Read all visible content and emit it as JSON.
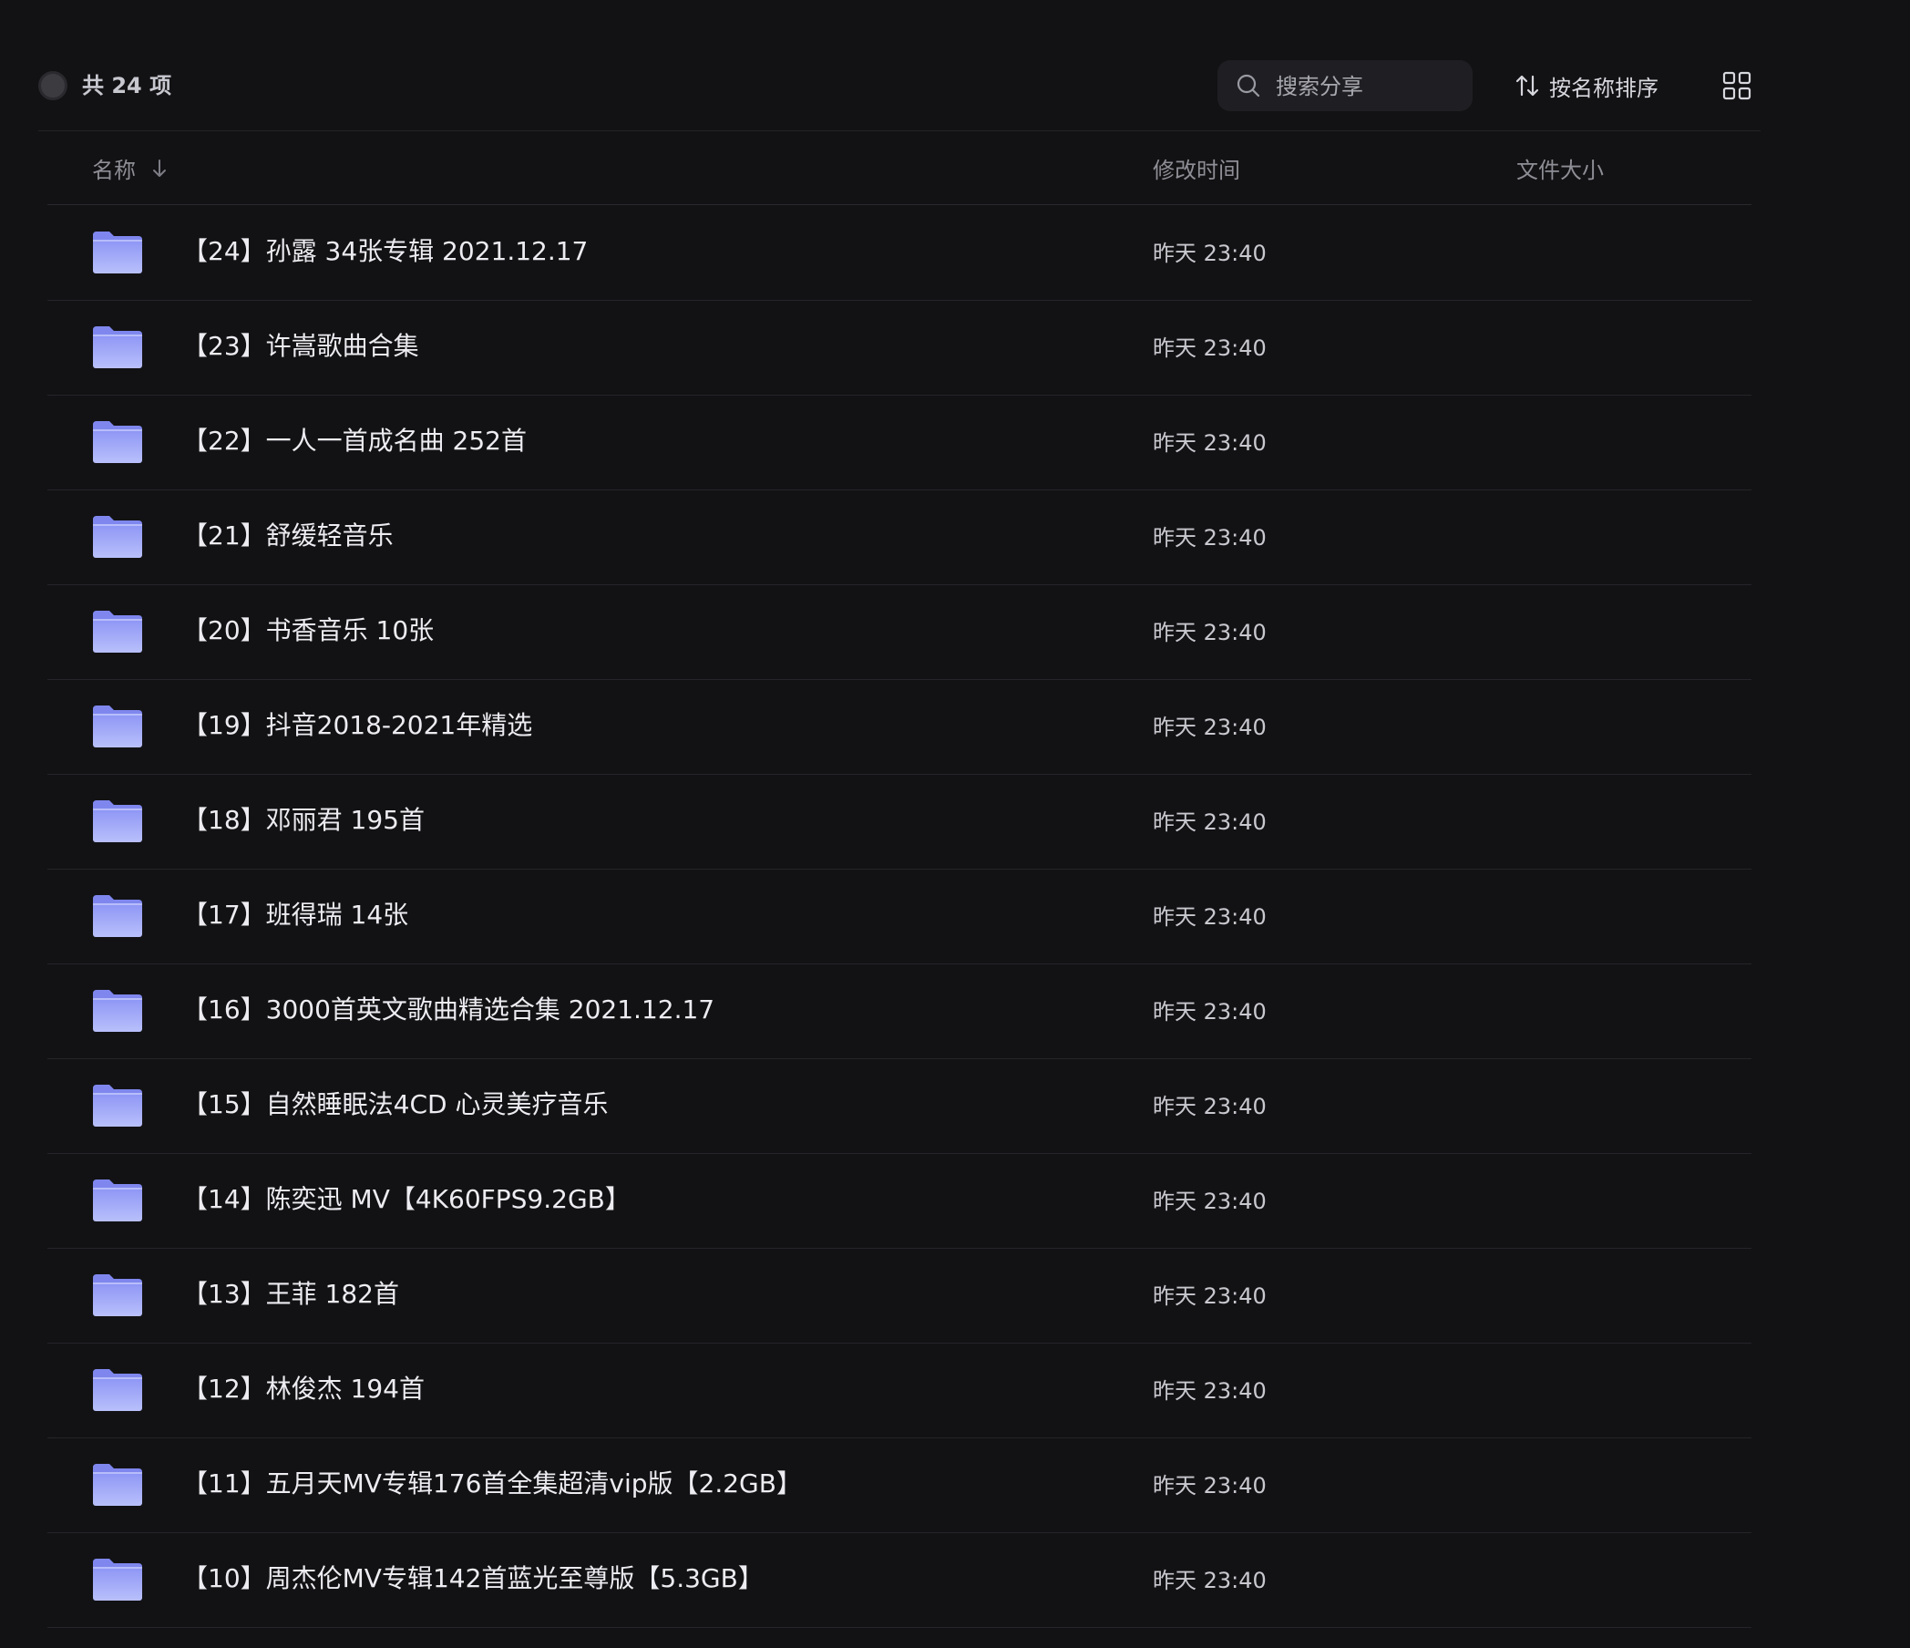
{
  "toolbar": {
    "count_label": "共 24 项",
    "search_placeholder": "搜索分享",
    "sort_label": "按名称排序"
  },
  "columns": {
    "name": "名称",
    "modified": "修改时间",
    "size": "文件大小"
  },
  "colors": {
    "background": "#121214",
    "folder_top": "#8d95f5",
    "folder_bottom": "#b9c0fb"
  },
  "icons": {
    "select": "circle-checkbox",
    "search": "search-icon",
    "sort": "sort-arrows-icon",
    "view": "grid-view-icon",
    "sort_direction": "arrow-down-icon",
    "item": "folder-icon"
  },
  "files": [
    {
      "name": "【24】孙露 34张专辑 2021.12.17",
      "modified": "昨天 23:40",
      "size": ""
    },
    {
      "name": "【23】许嵩歌曲合集",
      "modified": "昨天 23:40",
      "size": ""
    },
    {
      "name": "【22】一人一首成名曲 252首",
      "modified": "昨天 23:40",
      "size": ""
    },
    {
      "name": "【21】舒缓轻音乐",
      "modified": "昨天 23:40",
      "size": ""
    },
    {
      "name": "【20】书香音乐 10张",
      "modified": "昨天 23:40",
      "size": ""
    },
    {
      "name": "【19】抖音2018-2021年精选",
      "modified": "昨天 23:40",
      "size": ""
    },
    {
      "name": "【18】邓丽君 195首",
      "modified": "昨天 23:40",
      "size": ""
    },
    {
      "name": "【17】班得瑞 14张",
      "modified": "昨天 23:40",
      "size": ""
    },
    {
      "name": "【16】3000首英文歌曲精选合集 2021.12.17",
      "modified": "昨天 23:40",
      "size": ""
    },
    {
      "name": "【15】自然睡眠法4CD 心灵美疗音乐",
      "modified": "昨天 23:40",
      "size": ""
    },
    {
      "name": "【14】陈奕迅 MV【4K60FPS9.2GB】",
      "modified": "昨天 23:40",
      "size": ""
    },
    {
      "name": "【13】王菲 182首",
      "modified": "昨天 23:40",
      "size": ""
    },
    {
      "name": "【12】林俊杰 194首",
      "modified": "昨天 23:40",
      "size": ""
    },
    {
      "name": "【11】五月天MV专辑176首全集超清vip版【2.2GB】",
      "modified": "昨天 23:40",
      "size": ""
    },
    {
      "name": "【10】周杰伦MV专辑142首蓝光至尊版【5.3GB】",
      "modified": "昨天 23:40",
      "size": ""
    }
  ]
}
